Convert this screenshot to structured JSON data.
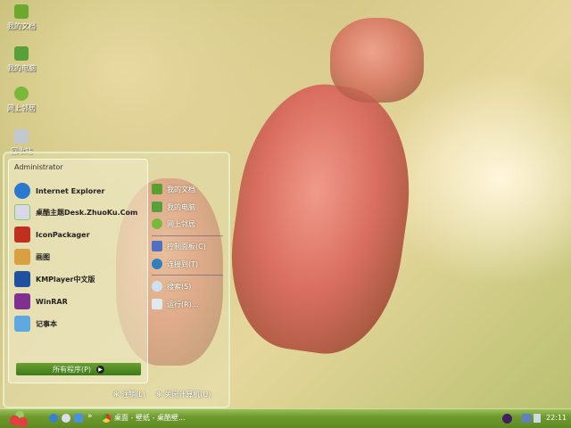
{
  "desktop": {
    "icons": [
      {
        "label": "我的文档",
        "icon": "folder-icon",
        "color": "#6aa82e"
      },
      {
        "label": "我的电脑",
        "icon": "computer-icon",
        "color": "#5aa03a"
      },
      {
        "label": "网上邻居",
        "icon": "network-icon",
        "color": "#7ab83a"
      },
      {
        "label": "回收站",
        "icon": "recycle-bin-icon",
        "color": "#c0c8d0"
      }
    ]
  },
  "start_menu": {
    "user": "Administrator",
    "programs": [
      {
        "label": "Internet Explorer",
        "icon": "ie-icon",
        "color": "#2a78d0"
      },
      {
        "label": "桌酷主题Desk.ZhuoKu.Com",
        "icon": "zhuoku-icon",
        "color": "#d8d8e8"
      },
      {
        "label": "IconPackager",
        "icon": "iconpackager-icon",
        "color": "#c03020"
      },
      {
        "label": "画图",
        "icon": "paint-icon",
        "color": "#d8a040"
      },
      {
        "label": "KMPlayer中文版",
        "icon": "kmplayer-icon",
        "color": "#2050a0"
      },
      {
        "label": "WinRAR",
        "icon": "winrar-icon",
        "color": "#803090"
      },
      {
        "label": "记事本",
        "icon": "notepad-icon",
        "color": "#60a8e0"
      }
    ],
    "all_programs": "所有程序(P)",
    "places": [
      {
        "label": "我的文档",
        "icon": "folder-icon",
        "color": "#5aa030"
      },
      {
        "label": "我的电脑",
        "icon": "computer-icon",
        "color": "#5aa03a"
      },
      {
        "label": "网上邻居",
        "icon": "network-icon",
        "color": "#7ab83a"
      }
    ],
    "system": [
      {
        "label": "控制面板(C)",
        "icon": "control-panel-icon",
        "color": "#5070c0"
      },
      {
        "label": "连接到(T)",
        "icon": "connect-icon",
        "color": "#3080c0"
      }
    ],
    "tools": [
      {
        "label": "搜索(S)",
        "icon": "search-icon",
        "color": "#d0e0f0"
      },
      {
        "label": "运行(R)...",
        "icon": "run-icon",
        "color": "#e0e8f0"
      }
    ],
    "logoff": "注销(L)",
    "shutdown": "关闭计算机(U)"
  },
  "taskbar": {
    "task": "桌面 - 壁纸 - 桌酷壁...",
    "more": "»",
    "clock": "22:11"
  }
}
